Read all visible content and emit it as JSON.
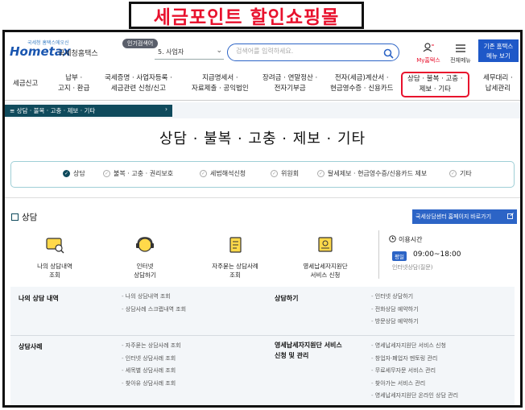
{
  "banner": {
    "text": "세금포인트 할인쇼핑몰"
  },
  "header": {
    "logo_tiny": "국세청 홈택스에오신",
    "logo_main": "Hometax",
    "logo_kr": "국세청홈택스",
    "popular_badge": "인기검색어",
    "keyword_select": "5.  사업자",
    "search_placeholder": "검색어를 입력하세요.",
    "my_hometax": "My홈택스",
    "full_menu": "전체메뉴",
    "classic_line1": "기존 홈택스",
    "classic_line2": "메뉴 보기"
  },
  "gnb": [
    {
      "line1": "세금신고",
      "line2": ""
    },
    {
      "line1": "납부 ·",
      "line2": "고지 · 환급"
    },
    {
      "line1": "국세증명 · 사업자등록 ·",
      "line2": "세금관련 신청/신고"
    },
    {
      "line1": "지급명세서 ·",
      "line2": "자료제출 · 공익법인"
    },
    {
      "line1": "장려금 · 연말정산 ·",
      "line2": "전자기부금"
    },
    {
      "line1": "전자(세금)계산서 ·",
      "line2": "현금영수증 · 신용카드"
    },
    {
      "line1": "상담 · 불복 · 고충 ·",
      "line2": "제보 · 기타"
    },
    {
      "line1": "세무대리 ·",
      "line2": "납세관리"
    }
  ],
  "breadcrumb": "상담 · 불복 · 고충 · 제보 · 기타",
  "page_title": "상담 · 불복 · 고충 · 제보 · 기타",
  "tabs": [
    {
      "label": "상담",
      "active": true
    },
    {
      "label": "불복 · 고충 · 권리보호",
      "active": false
    },
    {
      "label": "세법해석신청",
      "active": false
    },
    {
      "label": "위원회",
      "active": false
    },
    {
      "label": "탈세제보 · 현금영수증/신용카드 제보",
      "active": false
    },
    {
      "label": "기타",
      "active": false
    }
  ],
  "section": {
    "title": "상담",
    "center_button": "국세상담센터 홈페이지 바로가기"
  },
  "quick_links": [
    {
      "line1": "나의 상담내역",
      "line2": "조회"
    },
    {
      "line1": "인터넷",
      "line2": "상담하기"
    },
    {
      "line1": "자주묻는 상담사례",
      "line2": "조회"
    },
    {
      "line1": "영세납세자지원단",
      "line2": "서비스 신청"
    }
  ],
  "hours": {
    "title": "이용시간",
    "tag": "평일",
    "time": "09:00~18:00",
    "desc": "인터넷상담(질문)"
  },
  "link_table": {
    "row1": {
      "left_head": "나의 상담 내역",
      "left_items": [
        "나의 상담내역 조회",
        "상담사례 스크랩내역 조회"
      ],
      "right_head": "상담하기",
      "right_items": [
        "인터넷 상담하기",
        "전화상담 예약하기",
        "방문상담 예약하기"
      ]
    },
    "row2": {
      "left_head": "상담사례",
      "left_items": [
        "자주묻는 상담사례 조회",
        "인터넷 상담사례 조회",
        "세목별 상담사례 조회",
        "찾아유 상담사례 조회"
      ],
      "right_head_line1": "영세납세자지원단 서비스",
      "right_head_line2": "신청 및 관리",
      "right_items": [
        "영세납세자지원단 서비스 신청",
        "창업자·폐업자 멘토링 관리",
        "무료세무자문 서비스 관리",
        "찾아가는 서비스 관리",
        "영세납세자지원단 온라인 상담 관리"
      ]
    }
  },
  "colors": {
    "accent": "#2c64c6",
    "dark_teal": "#0f4a5c",
    "highlight_red": "#e8112d"
  }
}
